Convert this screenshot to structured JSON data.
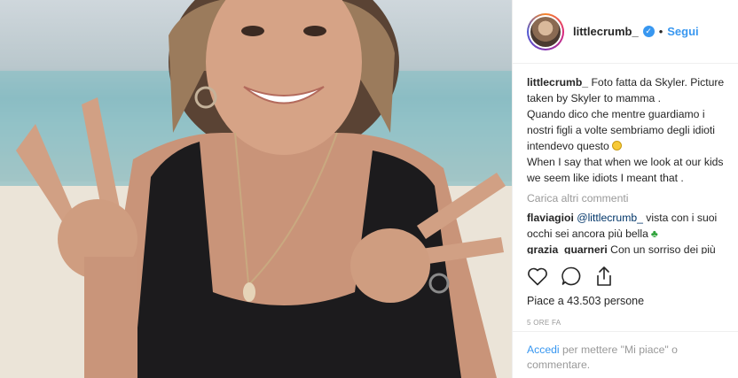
{
  "post": {
    "username": "littlecrumb_",
    "follow_label": "Segui",
    "separator": "•",
    "verified_mark": "✓"
  },
  "caption": {
    "username": "littlecrumb_",
    "lines": [
      "Foto fatta da Skyler. Picture",
      "taken by Skyler to mamma .",
      "Quando dico che mentre guardiamo i",
      "nostri figli a volte sembriamo degli idioti",
      "intendevo questo",
      "When I say that when we look at our kids",
      "we seem like idiots I meant that ."
    ]
  },
  "load_more": "Carica altri commenti",
  "comments": [
    {
      "username": "flaviagioi",
      "mention": "@littlecrumb_",
      "text_after_mention": " vista con i suoi",
      "text_line2": "occhi sei ancora più bella"
    },
    {
      "username": "grazia_guarneri",
      "text": "Con un sorriso dei più"
    }
  ],
  "likes_text": "Piace a 43.503 persone",
  "time_ago": "5 ORE FA",
  "login_prompt": {
    "link": "Accedi",
    "text": " per mettere \"Mi piace\" o commentare."
  },
  "icons": [
    "heart-icon",
    "comment-icon",
    "share-icon",
    "verified-badge-icon"
  ],
  "colors": {
    "link_blue": "#3897f0",
    "mention_blue": "#003569",
    "muted_gray": "#999999",
    "text_dark": "#262626"
  }
}
